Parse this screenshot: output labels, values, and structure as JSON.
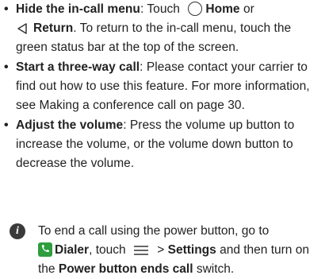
{
  "bullets": [
    {
      "term": "Hide the in-call menu",
      "sep": ": Touch ",
      "home_label": "Home",
      "or_text": " or",
      "back_label": "Return",
      "rest": ". To return to the in-call menu, touch the green status bar at the top of the screen."
    },
    {
      "term": "Start a three-way call",
      "text": ": Please contact your carrier to find out how to use this feature. For more information, see Making a conference call on page 30."
    },
    {
      "term": "Adjust the volume",
      "text": ": Press the volume up button to increase the volume, or the volume down button to decrease the volume."
    }
  ],
  "note": {
    "icon_glyph": "i",
    "part1": "To end a call using the power button, go to ",
    "dialer_label": "Dialer",
    "part2": ", touch ",
    "part3": " > ",
    "settings_label": "Settings",
    "part4": " and then turn on the ",
    "switch_label": "Power button ends call",
    "part5": " switch."
  },
  "icons": {
    "home": "home-circle-icon",
    "back": "back-triangle-icon",
    "info": "info-icon",
    "dialer": "dialer-phone-icon",
    "menu": "menu-lines-icon"
  },
  "colors": {
    "dialer_green": "#2e9e3f",
    "info_badge": "#3a3a3a"
  }
}
